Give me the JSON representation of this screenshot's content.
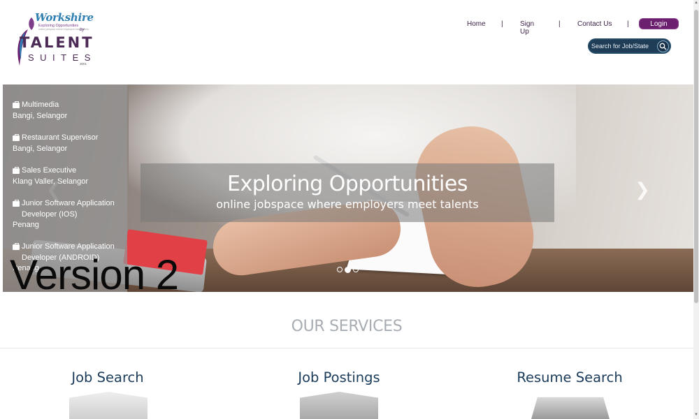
{
  "brand": {
    "name": "Workshire",
    "tagline": "Exploring Opportunities",
    "tagline_small": "online jobspace where employers meet talents",
    "by": "by",
    "talent": "TALENT",
    "suites": "SUITES",
    "edition": "3001"
  },
  "nav": {
    "items": [
      {
        "label": "Home"
      },
      {
        "label": "Sign Up"
      },
      {
        "label": "Contact Us"
      }
    ],
    "separator": "|",
    "login_label": "Login"
  },
  "search": {
    "placeholder": "Search for Job/State",
    "icon": "search-icon"
  },
  "carousel": {
    "title": "Exploring Opportunities",
    "subtitle": "online jobspace where employers meet talents",
    "next_icon": "chevron-right-icon",
    "prev_icon": "chevron-left-icon",
    "next_glyph": "❯",
    "prev_glyph": "❮",
    "slide_count": 3,
    "active_slide": 2
  },
  "jobs": [
    {
      "title": "Multimedia",
      "location": "Bangi, Selangor"
    },
    {
      "title": "Restaurant Supervisor",
      "location": "Bangi, Selangor"
    },
    {
      "title": "Sales Executive",
      "location": "Klang Valler, Selangor"
    },
    {
      "title": "Junior Software Application Developer (IOS)",
      "location": "Penang"
    },
    {
      "title": "Junior Software Application Developer (ANDROID)",
      "location": "Penang"
    }
  ],
  "overlay_text": "Version 2",
  "services": {
    "heading": "OUR SERVICES",
    "items": [
      {
        "label": "Job Search"
      },
      {
        "label": "Job Postings"
      },
      {
        "label": "Resume Search"
      }
    ]
  },
  "colors": {
    "brand_purple": "#6b1f6e",
    "nav_text": "#3a1f44",
    "search_bg": "#1f3d57",
    "service_title": "#1a3b5a",
    "services_heading": "#a7adb3"
  }
}
